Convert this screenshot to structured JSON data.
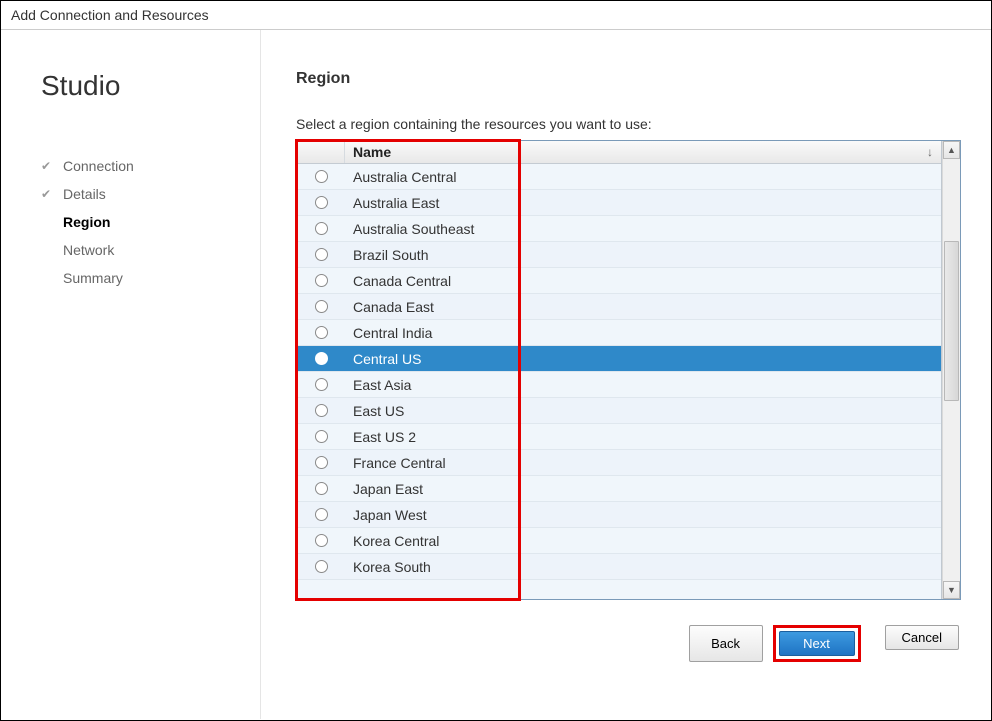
{
  "window": {
    "title": "Add Connection and Resources"
  },
  "sidebar": {
    "brand": "Studio",
    "steps": [
      {
        "label": "Connection",
        "state": "completed"
      },
      {
        "label": "Details",
        "state": "completed"
      },
      {
        "label": "Region",
        "state": "current"
      },
      {
        "label": "Network",
        "state": "future"
      },
      {
        "label": "Summary",
        "state": "future"
      }
    ]
  },
  "main": {
    "title": "Region",
    "instruction": "Select a region containing the resources you want to use:",
    "name_column": "Name",
    "regions": [
      {
        "name": "Australia Central",
        "selected": false
      },
      {
        "name": "Australia East",
        "selected": false
      },
      {
        "name": "Australia Southeast",
        "selected": false
      },
      {
        "name": "Brazil South",
        "selected": false
      },
      {
        "name": "Canada Central",
        "selected": false
      },
      {
        "name": "Canada East",
        "selected": false
      },
      {
        "name": "Central India",
        "selected": false
      },
      {
        "name": "Central US",
        "selected": true
      },
      {
        "name": "East Asia",
        "selected": false
      },
      {
        "name": "East US",
        "selected": false
      },
      {
        "name": "East US 2",
        "selected": false
      },
      {
        "name": "France Central",
        "selected": false
      },
      {
        "name": "Japan East",
        "selected": false
      },
      {
        "name": "Japan West",
        "selected": false
      },
      {
        "name": "Korea Central",
        "selected": false
      },
      {
        "name": "Korea South",
        "selected": false
      }
    ]
  },
  "buttons": {
    "back": "Back",
    "next": "Next",
    "cancel": "Cancel"
  }
}
